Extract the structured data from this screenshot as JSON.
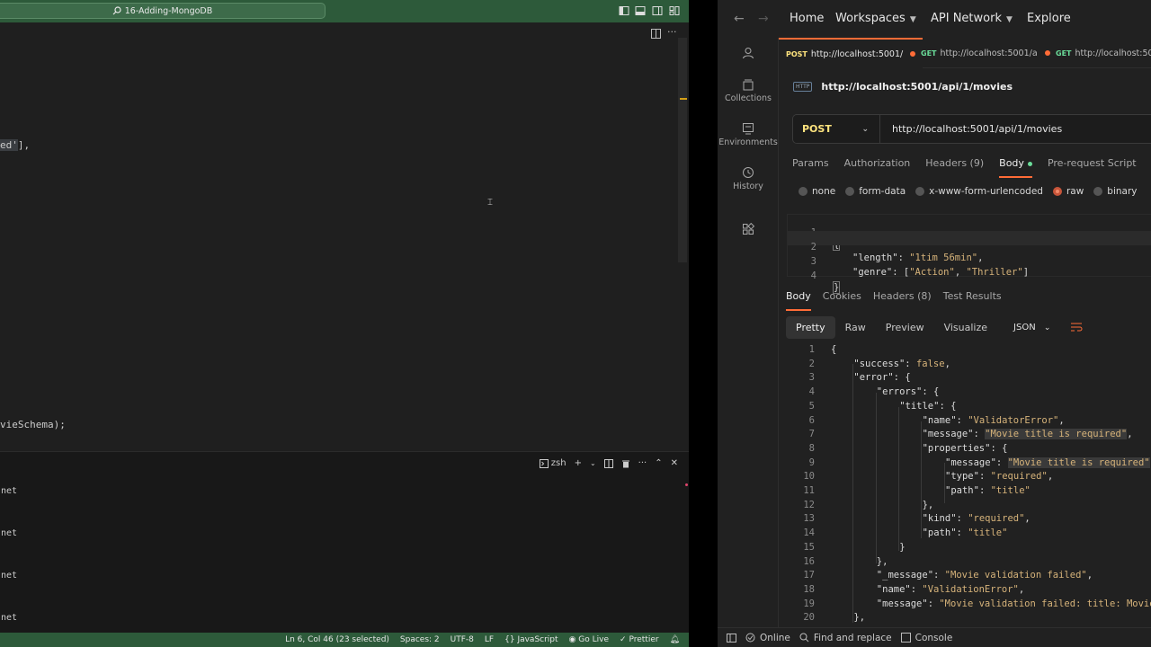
{
  "vscode": {
    "title": "16-Adding-MongoDB",
    "code_lines": [
      {
        "text": "ed'],",
        "sel": "ed'"
      },
      {
        "text": "vieSchema);"
      }
    ],
    "terminal": {
      "shell_label": "zsh",
      "lines": [
        "net",
        "net",
        "net",
        "net"
      ]
    },
    "status": {
      "position": "Ln 6, Col 46 (23 selected)",
      "spaces": "Spaces: 2",
      "encoding": "UTF-8",
      "eol": "LF",
      "language": "JavaScript",
      "golive": "Go Live",
      "prettier": "Prettier"
    }
  },
  "postman": {
    "nav": {
      "home": "Home",
      "workspaces": "Workspaces",
      "api_network": "API Network",
      "explore": "Explore"
    },
    "sidebar": [
      {
        "icon": "person-icon",
        "label": ""
      },
      {
        "icon": "collections-icon",
        "label": "Collections"
      },
      {
        "icon": "environments-icon",
        "label": "Environments"
      },
      {
        "icon": "history-icon",
        "label": "History"
      },
      {
        "icon": "apps-icon",
        "label": ""
      }
    ],
    "tabs": [
      {
        "method": "POST",
        "url": "http://localhost:5001/"
      },
      {
        "method": "GET",
        "url": "http://localhost:5001/a"
      },
      {
        "method": "GET",
        "url": "http://localhost:50"
      }
    ],
    "request": {
      "badge": "HTTP",
      "title": "http://localhost:5001/api/1/movies",
      "method": "POST",
      "url": "http://localhost:5001/api/1/movies",
      "subtabs": [
        "Params",
        "Authorization",
        "Headers (9)",
        "Body",
        "Pre-request Script"
      ],
      "body_types": [
        "none",
        "form-data",
        "x-www-form-urlencoded",
        "raw",
        "binary"
      ],
      "body_lines": [
        {
          "n": "1",
          "k": "",
          "v": ""
        },
        {
          "n": "2",
          "k": "\"length\"",
          "v": "\"1tim 56min\""
        },
        {
          "n": "3",
          "k": "\"genre\"",
          "v": ""
        },
        {
          "n": "4",
          "k": "",
          "v": ""
        }
      ],
      "genre_values": [
        "\"Action\"",
        "\"Thriller\""
      ]
    },
    "response": {
      "tabs": [
        "Body",
        "Cookies",
        "Headers (8)",
        "Test Results"
      ],
      "views": [
        "Pretty",
        "Raw",
        "Preview",
        "Visualize"
      ],
      "format": "JSON",
      "lines": [
        {
          "n": "1",
          "indent": 0,
          "key": "",
          "val": "{",
          "punct": ""
        },
        {
          "n": "2",
          "indent": 1,
          "key": "\"success\"",
          "val": "false",
          "punct": ","
        },
        {
          "n": "3",
          "indent": 1,
          "key": "\"error\"",
          "val": "{",
          "punct": ""
        },
        {
          "n": "4",
          "indent": 2,
          "key": "\"errors\"",
          "val": "{",
          "punct": ""
        },
        {
          "n": "5",
          "indent": 3,
          "key": "\"title\"",
          "val": "{",
          "punct": ""
        },
        {
          "n": "6",
          "indent": 4,
          "key": "\"name\"",
          "val": "\"ValidatorError\"",
          "punct": ","
        },
        {
          "n": "7",
          "indent": 4,
          "key": "\"message\"",
          "val": "\"Movie title is required\"",
          "punct": ","
        },
        {
          "n": "8",
          "indent": 4,
          "key": "\"properties\"",
          "val": "{",
          "punct": ""
        },
        {
          "n": "9",
          "indent": 5,
          "key": "\"message\"",
          "val": "\"Movie title is required\"",
          "punct": ","
        },
        {
          "n": "10",
          "indent": 5,
          "key": "\"type\"",
          "val": "\"required\"",
          "punct": ","
        },
        {
          "n": "11",
          "indent": 5,
          "key": "\"path\"",
          "val": "\"title\"",
          "punct": ""
        },
        {
          "n": "12",
          "indent": 4,
          "key": "",
          "val": "},",
          "punct": ""
        },
        {
          "n": "13",
          "indent": 4,
          "key": "\"kind\"",
          "val": "\"required\"",
          "punct": ","
        },
        {
          "n": "14",
          "indent": 4,
          "key": "\"path\"",
          "val": "\"title\"",
          "punct": ""
        },
        {
          "n": "15",
          "indent": 3,
          "key": "",
          "val": "}",
          "punct": ""
        },
        {
          "n": "16",
          "indent": 2,
          "key": "",
          "val": "},",
          "punct": ""
        },
        {
          "n": "17",
          "indent": 2,
          "key": "\"_message\"",
          "val": "\"Movie validation failed\"",
          "punct": ","
        },
        {
          "n": "18",
          "indent": 2,
          "key": "\"name\"",
          "val": "\"ValidationError\"",
          "punct": ","
        },
        {
          "n": "19",
          "indent": 2,
          "key": "\"message\"",
          "val": "\"Movie validation failed: title: Movie",
          "punct": ""
        },
        {
          "n": "20",
          "indent": 1,
          "key": "",
          "val": "},",
          "punct": ""
        }
      ]
    },
    "statusbar": {
      "online": "Online",
      "find": "Find and replace",
      "console": "Console"
    }
  }
}
